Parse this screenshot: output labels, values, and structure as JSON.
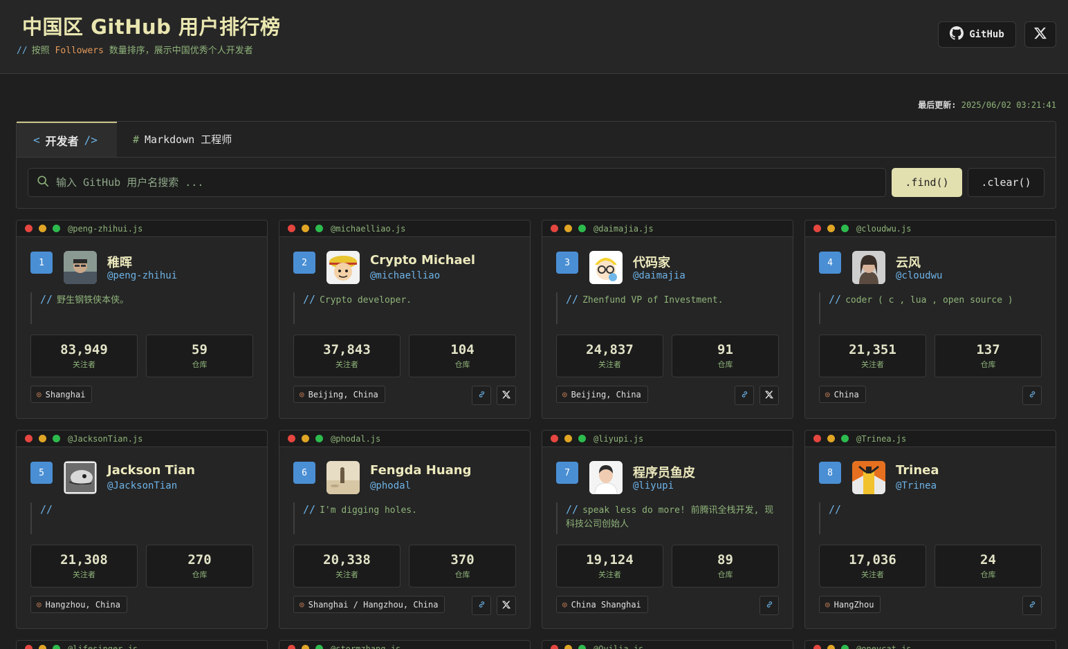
{
  "header": {
    "title": "中国区 GitHub 用户排行榜",
    "subtitle_prefix": "//",
    "subtitle_a": "按照",
    "subtitle_hl": "Followers",
    "subtitle_b": "数量排序，展示中国优秀个人开发者",
    "github_button": "GitHub",
    "x_icon": "x-logo-icon"
  },
  "updated": {
    "label": "最后更新:",
    "value": "2025/06/02 03:21:41"
  },
  "tabs": [
    {
      "open": "<",
      "label": "开发者",
      "close": "/>"
    },
    {
      "prefix": "#",
      "label": "Markdown 工程师"
    }
  ],
  "search": {
    "placeholder": "输入 GitHub 用户名搜索 ...",
    "value": "",
    "find_label": ".find()",
    "clear_label": ".clear()"
  },
  "stat_labels": {
    "followers": "关注者",
    "repos": "仓库"
  },
  "cards": [
    {
      "file": "@peng-zhihui.js",
      "rank": "1",
      "name": "稚晖",
      "handle": "@peng-zhihui",
      "bio_slash": "//",
      "bio": "野生钢铁侠本侠。",
      "followers": "83,949",
      "repos": "59",
      "location": "Shanghai",
      "blog": false,
      "x": false
    },
    {
      "file": "@michaelliao.js",
      "rank": "2",
      "name": "Crypto Michael",
      "handle": "@michaelliao",
      "bio_slash": "//",
      "bio": "Crypto developer.",
      "followers": "37,843",
      "repos": "104",
      "location": "Beijing, China",
      "blog": true,
      "x": true
    },
    {
      "file": "@daimajia.js",
      "rank": "3",
      "name": "代码家",
      "handle": "@daimajia",
      "bio_slash": "//",
      "bio": "Zhenfund VP of Investment.",
      "followers": "24,837",
      "repos": "91",
      "location": "Beijing, China",
      "blog": true,
      "x": true
    },
    {
      "file": "@cloudwu.js",
      "rank": "4",
      "name": "云风",
      "handle": "@cloudwu",
      "bio_slash": "//",
      "bio": "coder ( c , lua , open source )",
      "followers": "21,351",
      "repos": "137",
      "location": "China",
      "blog": true,
      "x": false
    },
    {
      "file": "@JacksonTian.js",
      "rank": "5",
      "name": "Jackson Tian",
      "handle": "@JacksonTian",
      "bio_slash": "//",
      "bio": "",
      "followers": "21,308",
      "repos": "270",
      "location": "Hangzhou, China",
      "blog": false,
      "x": false
    },
    {
      "file": "@phodal.js",
      "rank": "6",
      "name": "Fengda Huang",
      "handle": "@phodal",
      "bio_slash": "//",
      "bio": "I'm digging holes.",
      "followers": "20,338",
      "repos": "370",
      "location": "Shanghai / Hangzhou, China",
      "blog": true,
      "x": true
    },
    {
      "file": "@liyupi.js",
      "rank": "7",
      "name": "程序员鱼皮",
      "handle": "@liyupi",
      "bio_slash": "//",
      "bio": "speak less do more! 前腾讯全栈开发, 现科技公司创始人",
      "followers": "19,124",
      "repos": "89",
      "location": "China Shanghai",
      "blog": true,
      "x": false
    },
    {
      "file": "@Trinea.js",
      "rank": "8",
      "name": "Trinea",
      "handle": "@Trinea",
      "bio_slash": "//",
      "bio": "",
      "followers": "17,036",
      "repos": "24",
      "location": "HangZhou",
      "blog": true,
      "x": false
    }
  ],
  "partial_cards": [
    {
      "file": "@lifesinger.js"
    },
    {
      "file": "@stormzhang.js"
    },
    {
      "file": "@Ovilia.js"
    },
    {
      "file": "@onevcat.js"
    }
  ]
}
